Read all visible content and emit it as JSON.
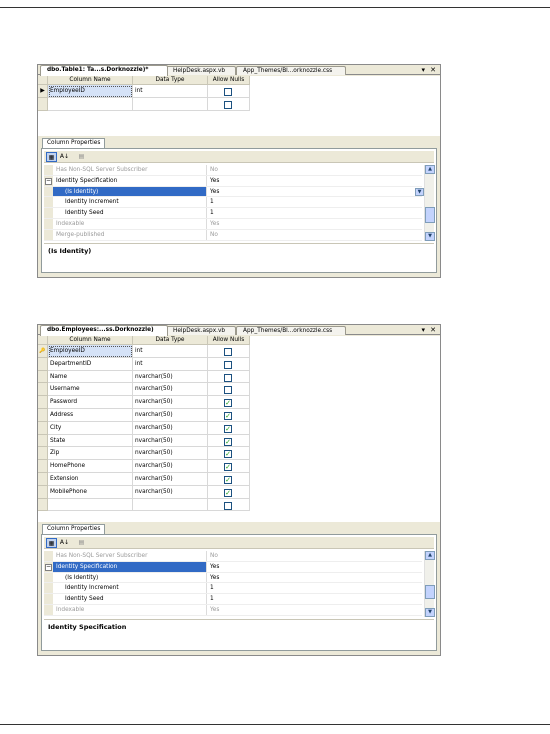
{
  "figure1": {
    "tabs": [
      "dbo.Table1: Ta...s.Dorknozzle)*",
      "HelpDesk.aspx.vb",
      "App_Themes/Bl...orknozzle.css"
    ],
    "columns": [
      "Column Name",
      "Data Type",
      "Allow Nulls"
    ],
    "rows": [
      {
        "name": "EmployeeID",
        "type": "int",
        "allow_nulls": false
      }
    ],
    "column_properties_tab": "Column Properties",
    "properties": [
      {
        "name": "Has Non-SQL Server Subscriber",
        "value": "No"
      },
      {
        "name": "Identity Specification",
        "value": "Yes"
      },
      {
        "name": "(Is Identity)",
        "value": "Yes"
      },
      {
        "name": "Identity Increment",
        "value": "1"
      },
      {
        "name": "Identity Seed",
        "value": "1"
      },
      {
        "name": "Indexable",
        "value": "Yes"
      },
      {
        "name": "Merge-published",
        "value": "No"
      }
    ],
    "description": "(Is Identity)"
  },
  "figure2": {
    "tabs": [
      "dbo.Employees:...ss.Dorknozzle)",
      "HelpDesk.aspx.vb",
      "App_Themes/Bl...orknozzle.css"
    ],
    "columns": [
      "Column Name",
      "Data Type",
      "Allow Nulls"
    ],
    "rows": [
      {
        "name": "EmployeeID",
        "type": "int",
        "allow_nulls": false
      },
      {
        "name": "DepartmentID",
        "type": "int",
        "allow_nulls": false
      },
      {
        "name": "Name",
        "type": "nvarchar(50)",
        "allow_nulls": false
      },
      {
        "name": "Username",
        "type": "nvarchar(50)",
        "allow_nulls": false
      },
      {
        "name": "Password",
        "type": "nvarchar(50)",
        "allow_nulls": true
      },
      {
        "name": "Address",
        "type": "nvarchar(50)",
        "allow_nulls": true
      },
      {
        "name": "City",
        "type": "nvarchar(50)",
        "allow_nulls": true
      },
      {
        "name": "State",
        "type": "nvarchar(50)",
        "allow_nulls": true
      },
      {
        "name": "Zip",
        "type": "nvarchar(50)",
        "allow_nulls": true
      },
      {
        "name": "HomePhone",
        "type": "nvarchar(50)",
        "allow_nulls": true
      },
      {
        "name": "Extension",
        "type": "nvarchar(50)",
        "allow_nulls": true
      },
      {
        "name": "MobilePhone",
        "type": "nvarchar(50)",
        "allow_nulls": true
      }
    ],
    "column_properties_tab": "Column Properties",
    "properties": [
      {
        "name": "Has Non-SQL Server Subscriber",
        "value": "No"
      },
      {
        "name": "Identity Specification",
        "value": "Yes"
      },
      {
        "name": "(Is Identity)",
        "value": "Yes"
      },
      {
        "name": "Identity Increment",
        "value": "1"
      },
      {
        "name": "Identity Seed",
        "value": "1"
      },
      {
        "name": "Indexable",
        "value": "Yes"
      }
    ],
    "description": "Identity Specification"
  },
  "glyphs": {
    "close": "✕",
    "pin": "▾",
    "row_current": "▶",
    "key": "🔑",
    "check": "✓",
    "collapse": "−",
    "scroll_up": "▲",
    "scroll_down": "▼",
    "dropdown": "▼",
    "sort_alpha": "A↓"
  }
}
